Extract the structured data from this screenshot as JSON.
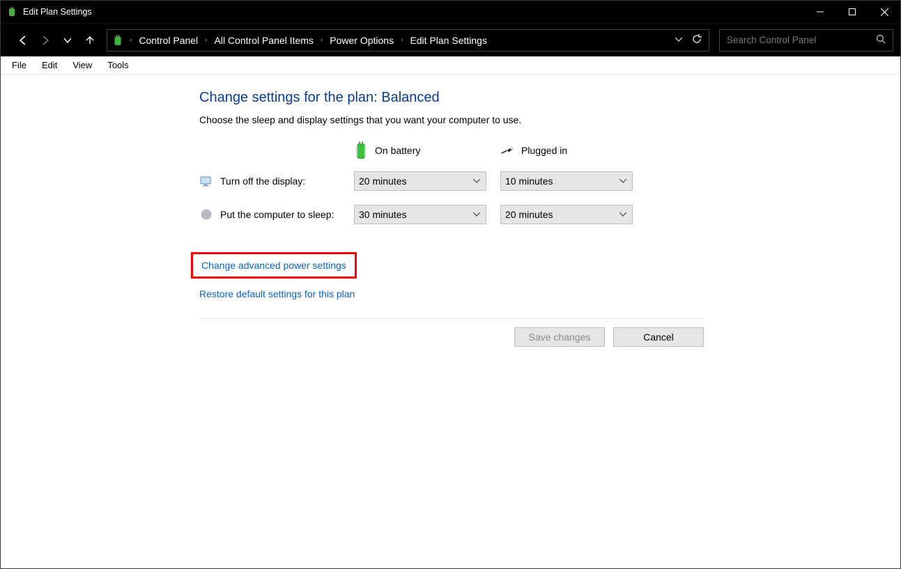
{
  "window": {
    "title": "Edit Plan Settings"
  },
  "breadcrumbs": {
    "items": [
      "Control Panel",
      "All Control Panel Items",
      "Power Options",
      "Edit Plan Settings"
    ]
  },
  "search": {
    "placeholder": "Search Control Panel"
  },
  "menubar": {
    "items": [
      "File",
      "Edit",
      "View",
      "Tools"
    ]
  },
  "page": {
    "heading": "Change settings for the plan: Balanced",
    "subtitle": "Choose the sleep and display settings that you want your computer to use.",
    "headers": {
      "battery": "On battery",
      "plugged": "Plugged in"
    },
    "rows": {
      "display": {
        "label": "Turn off the display:",
        "battery_value": "20 minutes",
        "plugged_value": "10 minutes"
      },
      "sleep": {
        "label": "Put the computer to sleep:",
        "battery_value": "30 minutes",
        "plugged_value": "20 minutes"
      }
    },
    "links": {
      "advanced": "Change advanced power settings",
      "restore": "Restore default settings for this plan"
    },
    "buttons": {
      "save": "Save changes",
      "cancel": "Cancel"
    }
  }
}
